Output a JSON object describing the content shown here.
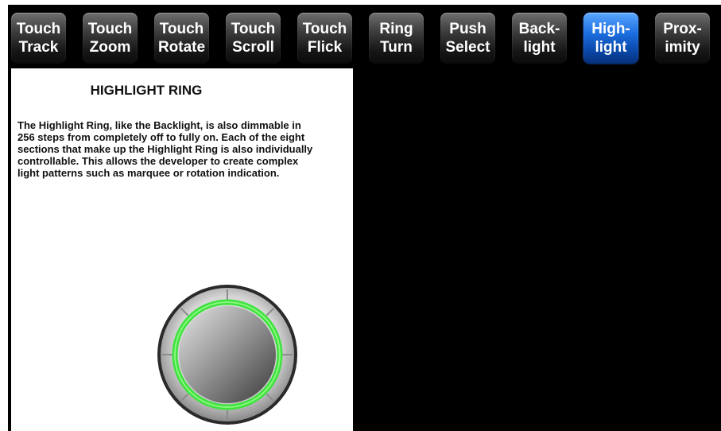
{
  "tabs": [
    {
      "line1": "Touch",
      "line2": "Track",
      "active": false
    },
    {
      "line1": "Touch",
      "line2": "Zoom",
      "active": false
    },
    {
      "line1": "Touch",
      "line2": "Rotate",
      "active": false
    },
    {
      "line1": "Touch",
      "line2": "Scroll",
      "active": false
    },
    {
      "line1": "Touch",
      "line2": "Flick",
      "active": false
    },
    {
      "line1": "Ring",
      "line2": "Turn",
      "active": false
    },
    {
      "line1": "Push",
      "line2": "Select",
      "active": false
    },
    {
      "line1": "Back-",
      "line2": "light",
      "active": false
    },
    {
      "line1": "High-",
      "line2": "light",
      "active": true
    },
    {
      "line1": "Prox-",
      "line2": "imity",
      "active": false
    }
  ],
  "panel": {
    "title": "HIGHLIGHT RING",
    "body": "The Highlight Ring, like the Backlight, is also dimmable in 256 steps from completely off to fully on. Each of the eight sections that make up the Highlight Ring is also individually controllable. This allows the developer to create complex light patterns such as marquee or rotation indication."
  },
  "colors": {
    "background": "#000000",
    "panel": "#ffffff",
    "tab_inactive": "#3a3a3a",
    "tab_active": "#1c6fe0",
    "ring_highlight": "#3ee23e"
  },
  "icons": {
    "knob": "highlight-ring-knob-icon"
  }
}
